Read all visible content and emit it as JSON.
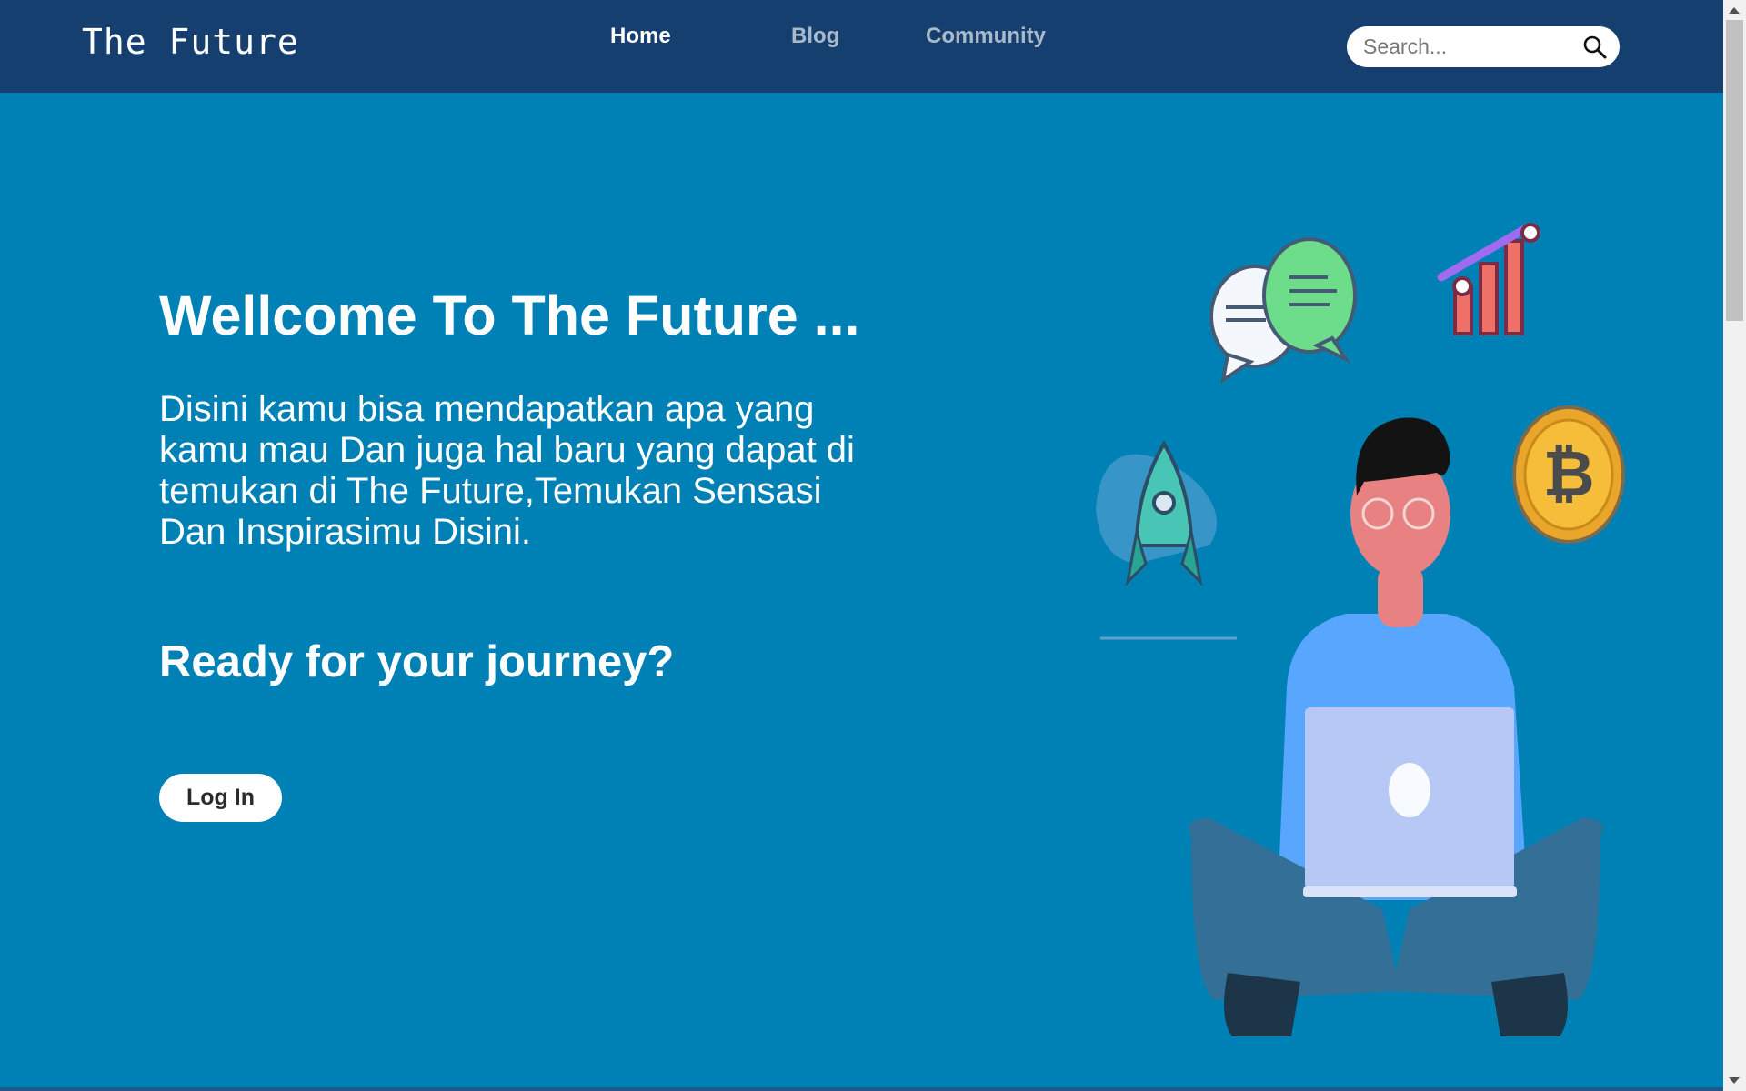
{
  "navbar": {
    "brand": "The Future",
    "links": [
      {
        "label": "Home",
        "active": true
      },
      {
        "label": "Blog",
        "active": false
      },
      {
        "label": "Community",
        "active": false
      }
    ],
    "search": {
      "placeholder": "Search...",
      "value": "",
      "icon": "search-icon"
    }
  },
  "hero": {
    "title": "Wellcome To The Future ...",
    "description": "Disini kamu bisa mendapatkan apa yang kamu mau Dan juga hal baru yang dapat di temukan di The Future,Temukan Sensasi Dan Inspirasimu Disini.",
    "question": "Ready for your journey?",
    "login_label": "Log In"
  },
  "illustration": {
    "icons": [
      "chat-bubbles-icon",
      "growth-chart-icon",
      "rocket-icon",
      "bitcoin-coin-icon"
    ],
    "subject": "person-with-laptop"
  },
  "colors": {
    "navbar": "#153f6f",
    "hero_background": "#0081b6",
    "text": "#ffffff",
    "inactive_link": "#a9b9cb"
  }
}
